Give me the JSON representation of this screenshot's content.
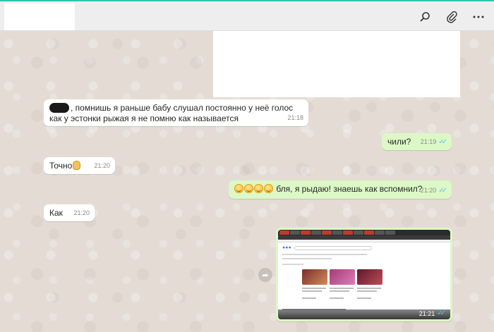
{
  "header": {
    "icons": [
      "search-icon",
      "attach-icon",
      "menu-icon"
    ],
    "icon_glyphs": {
      "search": "⚲",
      "attach": "📎",
      "menu": "⋯"
    }
  },
  "messages": [
    {
      "id": "m1",
      "direction": "in",
      "text": ", помнишь я раньше бабу слушал постоянно у неё голос как у эстонки рыжая я не помню как называется",
      "time": "21:18"
    },
    {
      "id": "m2",
      "direction": "out",
      "text": "чили?",
      "time": "21:19"
    },
    {
      "id": "m3",
      "direction": "in",
      "text": "Точно",
      "time": "21:20"
    },
    {
      "id": "m4",
      "direction": "out",
      "text": "бля, я рыдаю! знаешь как вспомнил?",
      "time": "21:20"
    },
    {
      "id": "m5",
      "direction": "in",
      "text": "Как",
      "time": "21:20"
    },
    {
      "id": "m6",
      "direction": "out",
      "type": "image",
      "time": "21:21"
    }
  ],
  "colors": {
    "incoming": "#ffffff",
    "outgoing": "#dcf8c6",
    "read_ticks": "#4fc3f7",
    "accent": "#2bc4b4"
  }
}
